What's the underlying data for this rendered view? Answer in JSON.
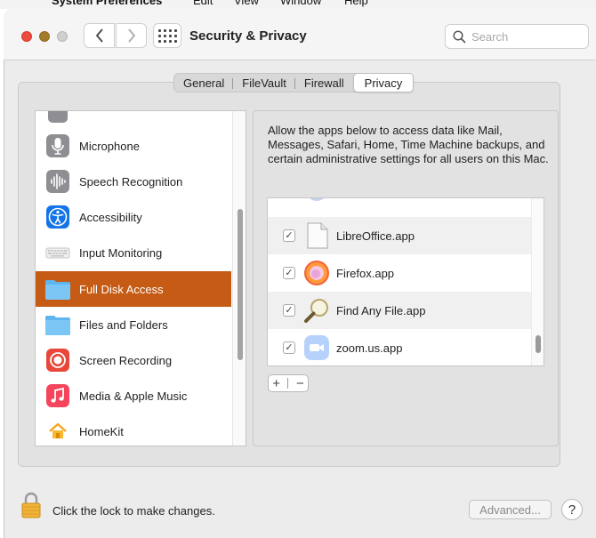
{
  "menubar": {
    "app_name": "System Preferences",
    "items": [
      "Edit",
      "View",
      "Window",
      "Help"
    ]
  },
  "window": {
    "title": "Security & Privacy"
  },
  "search": {
    "placeholder": "Search"
  },
  "tabs": [
    {
      "label": "General",
      "active": false
    },
    {
      "label": "FileVault",
      "active": false
    },
    {
      "label": "Firewall",
      "active": false
    },
    {
      "label": "Privacy",
      "active": true
    }
  ],
  "sidebar": {
    "items": [
      {
        "label": "Microphone",
        "icon": "microphone-icon"
      },
      {
        "label": "Speech Recognition",
        "icon": "waveform-icon"
      },
      {
        "label": "Accessibility",
        "icon": "accessibility-icon"
      },
      {
        "label": "Input Monitoring",
        "icon": "keyboard-icon"
      },
      {
        "label": "Full Disk Access",
        "icon": "folder-icon",
        "selected": true
      },
      {
        "label": "Files and Folders",
        "icon": "folder-icon"
      },
      {
        "label": "Screen Recording",
        "icon": "screen-recording-icon"
      },
      {
        "label": "Media & Apple Music",
        "icon": "music-note-icon"
      },
      {
        "label": "HomeKit",
        "icon": "home-icon"
      }
    ]
  },
  "main": {
    "description": "Allow the apps below to access data like Mail, Messages, Safari, Home, Time Machine backups, and certain administrative settings for all users on this Mac.",
    "apps": [
      {
        "label": "LibreOffice.app",
        "checked": true,
        "icon": "document-icon"
      },
      {
        "label": "Firefox.app",
        "checked": true,
        "icon": "firefox-icon"
      },
      {
        "label": "Find Any File.app",
        "checked": true,
        "icon": "magnifier-icon"
      },
      {
        "label": "zoom.us.app",
        "checked": true,
        "icon": "video-camera-icon"
      }
    ],
    "add_label": "+",
    "remove_label": "−"
  },
  "footer": {
    "lock_text": "Click the lock to make changes.",
    "advanced_label": "Advanced...",
    "help_label": "?"
  },
  "colors": {
    "selection": "#c55b14",
    "close": "#ee4b3f",
    "minimize": "#a47b2b",
    "zoom": "#cfcfcf"
  }
}
